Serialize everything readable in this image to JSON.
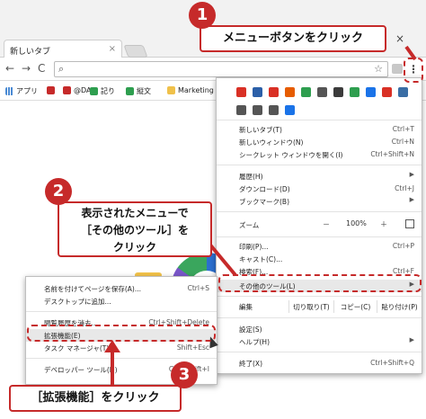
{
  "browser": {
    "tab_title": "新しいタブ",
    "tab_close": "×",
    "window_close": "×",
    "back": "←",
    "forward": "→",
    "reload": "C",
    "menu_icon": "⋮",
    "search_glyph": "⌕",
    "star_glyph": "☆"
  },
  "bookmarks": [
    {
      "label": "アプリ",
      "icon": "apps-grid-icon",
      "color": "#4a8ad4"
    },
    {
      "label": "",
      "icon": "itmedia-logo-icon",
      "color": "#c62a2a"
    },
    {
      "label": "@DA",
      "icon": "itmedia-logo-icon",
      "color": "#c62a2a"
    },
    {
      "label": "記り",
      "icon": "green-app-icon",
      "color": "#2e9e4f"
    },
    {
      "label": "縦文",
      "icon": "green-app-icon",
      "color": "#2e9e4f"
    },
    {
      "label": "Marketing",
      "icon": "folder-icon",
      "color": "#f0c14a"
    }
  ],
  "menu": {
    "ext_icon_colors": [
      "#d93025",
      "#2b5fa8",
      "#d93025",
      "#e65c00",
      "#2e9e4f",
      "#555555",
      "#3b3b3b",
      "#2e9e4f",
      "#1a73e8",
      "#d93025",
      "#3a6ea5",
      "#555555",
      "#555555",
      "#555555",
      "#1a73e8"
    ],
    "items": [
      {
        "label": "新しいタブ(T)",
        "shortcut": "Ctrl+T"
      },
      {
        "label": "新しいウィンドウ(N)",
        "shortcut": "Ctrl+N"
      },
      {
        "label": "シークレット ウィンドウを開く(I)",
        "shortcut": "Ctrl+Shift+N"
      },
      {
        "label": "履歴(H)",
        "shortcut": ""
      },
      {
        "label": "ダウンロード(D)",
        "shortcut": "Ctrl+J"
      },
      {
        "label": "ブックマーク(B)",
        "shortcut": ""
      },
      {
        "label": "印刷(P)...",
        "shortcut": "Ctrl+P"
      },
      {
        "label": "キャスト(C)...",
        "shortcut": ""
      },
      {
        "label": "検索(F)...",
        "shortcut": "Ctrl+F"
      },
      {
        "label": "その他のツール(L)",
        "shortcut": ""
      },
      {
        "label": "設定(S)",
        "shortcut": ""
      },
      {
        "label": "ヘルプ(H)",
        "shortcut": ""
      },
      {
        "label": "終了(X)",
        "shortcut": "Ctrl+Shift+Q"
      }
    ],
    "zoom": {
      "label": "ズーム",
      "minus": "－",
      "value": "100%",
      "plus": "＋"
    },
    "edit": {
      "label": "編集",
      "cut": "切り取り(T)",
      "copy": "コピー(C)",
      "paste": "貼り付け(P)"
    },
    "submenu_arrow": "▶"
  },
  "submenu": {
    "items": [
      {
        "label": "名前を付けてページを保存(A)...",
        "shortcut": "Ctrl+S"
      },
      {
        "label": "デスクトップに追加...",
        "shortcut": ""
      },
      {
        "label": "閲覧履歴を消去...",
        "shortcut": "Ctrl+Shift+Delete"
      },
      {
        "label": "拡張機能(E)",
        "shortcut": ""
      },
      {
        "label": "タスク マネージャ(T)",
        "shortcut": "Shift+Esc"
      },
      {
        "label": "デベロッパー ツール(D)",
        "shortcut": "Ctrl+Shift+I"
      }
    ]
  },
  "callouts": {
    "c1": {
      "number": "1",
      "text": "メニューボタンをクリック"
    },
    "c2": {
      "number": "2",
      "line1": "表示されたメニューで",
      "line2": "［その他のツール］を",
      "line3": "クリック"
    },
    "c3": {
      "number": "3",
      "text": "［拡張機能］をクリック"
    }
  },
  "colors": {
    "accent": "#c62a2a"
  }
}
